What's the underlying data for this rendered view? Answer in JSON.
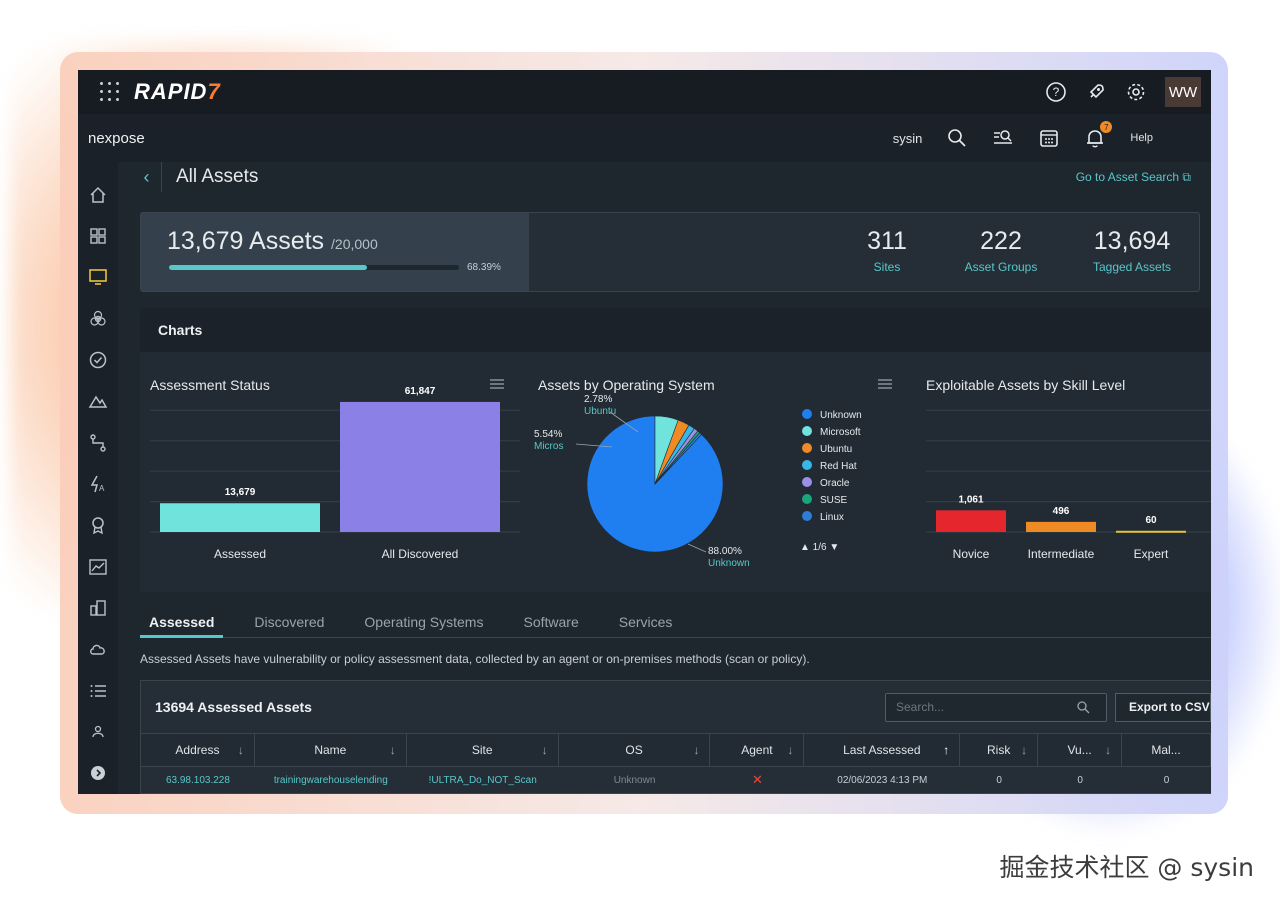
{
  "brand": {
    "name_a": "RAPID",
    "name_b": "7",
    "product": "nexpose",
    "avatar": "WW"
  },
  "subbar": {
    "user": "sysin",
    "help": "Help",
    "notification_count": "7"
  },
  "header": {
    "title": "All Assets",
    "asset_search_link": "Go to Asset Search ⧉"
  },
  "stats": {
    "asset_count": "13,679 Assets",
    "asset_limit": "/20,000",
    "usage_pct": "68.39%",
    "usage_fraction": 0.6839,
    "sites_value": "311",
    "sites_label": "Sites",
    "groups_value": "222",
    "groups_label": "Asset Groups",
    "tagged_value": "13,694",
    "tagged_label": "Tagged Assets"
  },
  "charts_header": "Charts",
  "chart_data": [
    {
      "type": "bar",
      "title": "Assessment Status",
      "categories": [
        "Assessed",
        "All Discovered"
      ],
      "values": [
        13679,
        61847
      ],
      "value_labels": [
        "13,679",
        "61,847"
      ],
      "colors": [
        "#6fe3dc",
        "#8b80e6"
      ],
      "ylim": [
        0,
        68000
      ]
    },
    {
      "type": "pie",
      "title": "Assets by Operating System",
      "labels": [
        "Unknown",
        "Microsoft",
        "Ubuntu",
        "Red Hat",
        "Oracle",
        "SUSE",
        "Linux"
      ],
      "values": [
        88.0,
        5.54,
        2.78,
        1.5,
        1.0,
        0.6,
        0.58
      ],
      "colors": [
        "#1f7ef0",
        "#6fe3dc",
        "#f08a24",
        "#38b6e8",
        "#9b8fe6",
        "#1aa67a",
        "#2f7dd8"
      ],
      "annotations": [
        {
          "pct": "2.78%",
          "name": "Ubuntu"
        },
        {
          "pct": "5.54%",
          "name": "Micros"
        },
        {
          "pct": "88.00%",
          "name": "Unknown"
        }
      ],
      "legend_page": "1/6",
      "legend": "right"
    },
    {
      "type": "bar",
      "title": "Exploitable Assets by Skill Level",
      "categories": [
        "Novice",
        "Intermediate",
        "Expert"
      ],
      "values": [
        1061,
        496,
        60
      ],
      "value_labels": [
        "1,061",
        "496",
        "60"
      ],
      "colors": [
        "#e5262d",
        "#f08a24",
        "#e8c23a"
      ],
      "ylim": [
        0,
        7000
      ]
    }
  ],
  "tabs": [
    {
      "label": "Assessed",
      "active": true
    },
    {
      "label": "Discovered",
      "active": false
    },
    {
      "label": "Operating Systems",
      "active": false
    },
    {
      "label": "Software",
      "active": false
    },
    {
      "label": "Services",
      "active": false
    }
  ],
  "tab_description": "Assessed Assets have vulnerability or policy assessment data, collected by an agent or on-premises methods (scan or policy).",
  "table": {
    "title": "13694 Assessed Assets",
    "search_placeholder": "Search...",
    "export_label": "Export to CSV",
    "columns": [
      "Address",
      "Name",
      "Site",
      "OS",
      "Agent",
      "Last Assessed",
      "Risk",
      "Vu...",
      "Mal..."
    ],
    "rows": [
      [
        "63.98.103.228",
        "trainingwarehouselending",
        "!ULTRA_Do_NOT_Scan",
        "Unknown",
        "✕",
        "02/06/2023 4:13 PM",
        "0",
        "0",
        "0"
      ]
    ]
  }
}
